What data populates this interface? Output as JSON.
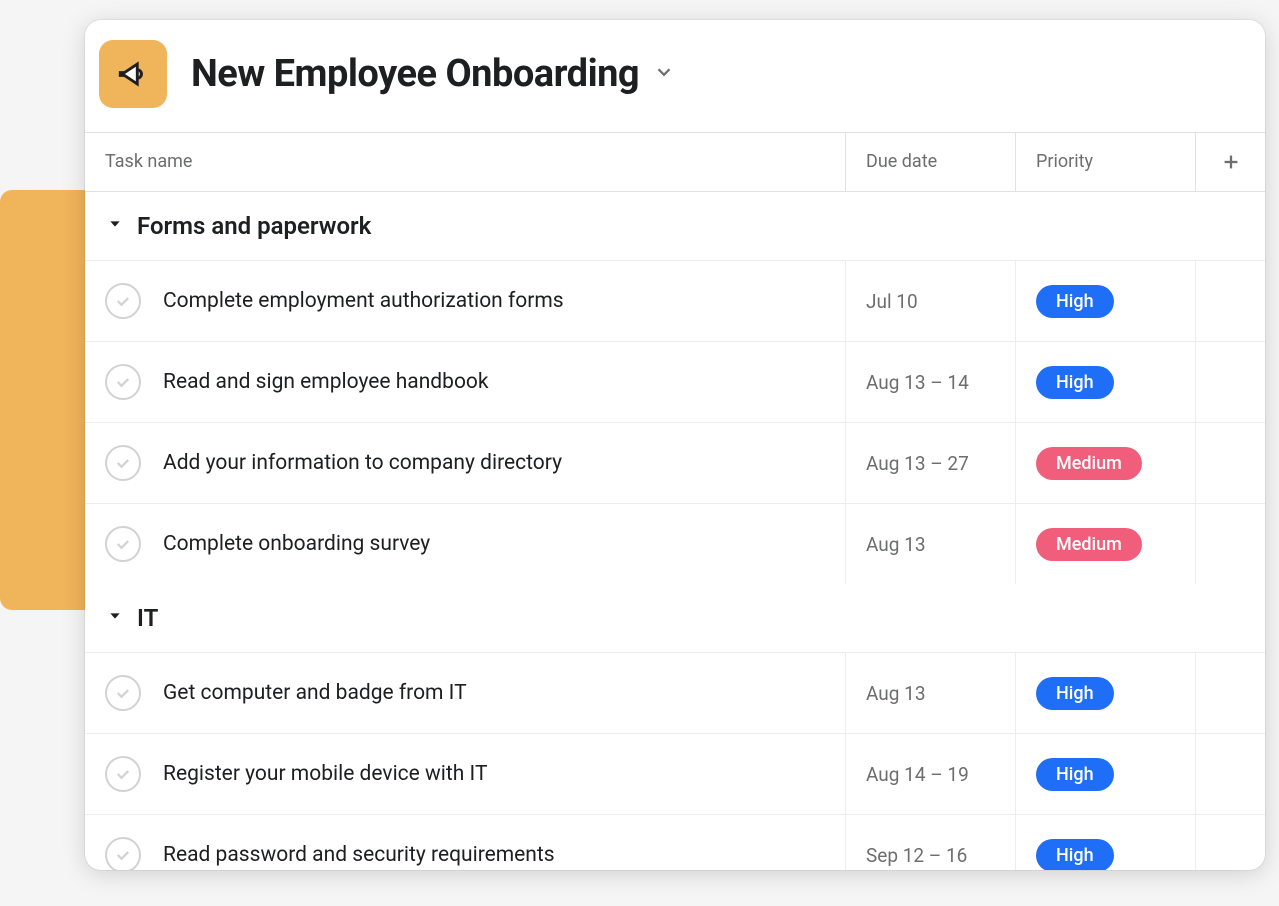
{
  "header": {
    "title": "New Employee Onboarding"
  },
  "columns": {
    "task_name": "Task name",
    "due_date": "Due date",
    "priority": "Priority"
  },
  "sections": [
    {
      "title": "Forms and paperwork",
      "tasks": [
        {
          "name": "Complete employment authorization forms",
          "due": "Jul 10",
          "priority": "High",
          "priority_class": "high"
        },
        {
          "name": "Read and sign employee handbook",
          "due": "Aug 13 – 14",
          "priority": "High",
          "priority_class": "high"
        },
        {
          "name": "Add your information to company directory",
          "due": "Aug 13 – 27",
          "priority": "Medium",
          "priority_class": "medium"
        },
        {
          "name": "Complete onboarding survey",
          "due": "Aug 13",
          "priority": "Medium",
          "priority_class": "medium"
        }
      ]
    },
    {
      "title": "IT",
      "tasks": [
        {
          "name": "Get computer and badge from IT",
          "due": "Aug 13",
          "priority": "High",
          "priority_class": "high"
        },
        {
          "name": "Register your mobile device with IT",
          "due": "Aug 14 – 19",
          "priority": "High",
          "priority_class": "high"
        },
        {
          "name": "Read password and security requirements",
          "due": "Sep 12 – 16",
          "priority": "High",
          "priority_class": "high"
        }
      ]
    }
  ]
}
